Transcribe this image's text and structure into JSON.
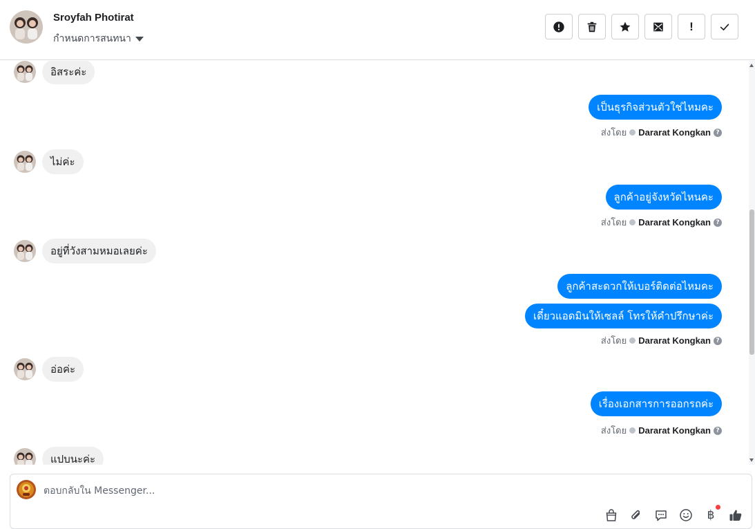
{
  "header": {
    "contact_name": "Sroyfah Photirat",
    "assign_label": "กำหนดการสนทนา",
    "actions": [
      {
        "name": "mark-spam-button",
        "icon": "alert-circle-icon"
      },
      {
        "name": "delete-button",
        "icon": "trash-icon"
      },
      {
        "name": "star-button",
        "icon": "star-icon"
      },
      {
        "name": "mark-unread-button",
        "icon": "envelope-icon"
      },
      {
        "name": "follow-up-button",
        "icon": "exclamation-icon",
        "text": "!"
      },
      {
        "name": "mark-done-button",
        "icon": "check-icon"
      }
    ]
  },
  "messages": {
    "m1": "อิสระค่ะ",
    "m2": "เป็นธุรกิจส่วนตัวใช่ไหมคะ",
    "m3": "ไม่ค่ะ",
    "m4": "ลูกค้าอยู่จังหวัดไหนคะ",
    "m5": "อยู่ที่วังสามหมอเลยค่ะ",
    "m6": "ลูกค้าสะดวกให้เบอร์ติดต่อไหมคะ",
    "m7": "เดี๋ยวแอดมินให้เซลล์ โทรให้คำปรึกษาค่ะ",
    "m8": "อ่อค่ะ",
    "m9": "เรื่องเอกสารการออกรถค่ะ",
    "m10": "แปบนะค่ะ"
  },
  "sent_by": {
    "label": "ส่งโดย",
    "agent": "Dararat Kongkan"
  },
  "composer": {
    "placeholder": "ตอบกลับใน Messenger...",
    "baht_symbol": "฿"
  },
  "colors": {
    "outgoing_bubble": "#0084ff",
    "incoming_bubble": "#f0f0f0",
    "notification_dot": "#fa3e3e"
  }
}
